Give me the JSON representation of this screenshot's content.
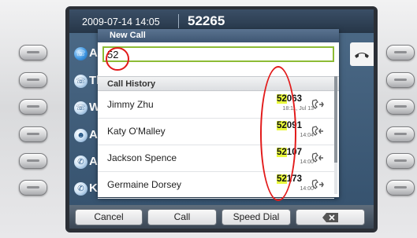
{
  "status_bar": {
    "datetime": "2009-07-14 14:05",
    "extension": "52265"
  },
  "lines": [
    {
      "label": "Ali",
      "icon": "phone-line-icon"
    },
    {
      "label": "Th",
      "icon": "phone-line-icon"
    },
    {
      "label": "We",
      "icon": "phone-line-icon"
    },
    {
      "label": "All",
      "icon": "group-icon"
    },
    {
      "label": "An",
      "icon": "speed-dial-icon"
    },
    {
      "label": "Ka",
      "icon": "speed-dial-icon"
    }
  ],
  "popup": {
    "title": "New Call",
    "input_value": "52",
    "section_label": "Call History"
  },
  "history": [
    {
      "name": "Jimmy Zhu",
      "num_prefix": "52",
      "num_rest": "063",
      "time": "18:11, Jul 13",
      "icon": "outgoing-call-icon"
    },
    {
      "name": "Katy O'Malley",
      "num_prefix": "52",
      "num_rest": "091",
      "time": "14:04",
      "icon": "incoming-call-icon"
    },
    {
      "name": "Jackson Spence",
      "num_prefix": "52",
      "num_rest": "107",
      "time": "14:00",
      "icon": "incoming-call-icon"
    },
    {
      "name": "Germaine Dorsey",
      "num_prefix": "52",
      "num_rest": "173",
      "time": "14:00",
      "icon": "outgoing-call-icon"
    }
  ],
  "softkeys": {
    "cancel": "Cancel",
    "call": "Call",
    "speed_dial": "Speed Dial",
    "backspace_icon": "backspace-icon"
  },
  "colors": {
    "input_border": "#8dbb35",
    "highlight": "#e8f83a",
    "annotation": "#e21a1a"
  }
}
